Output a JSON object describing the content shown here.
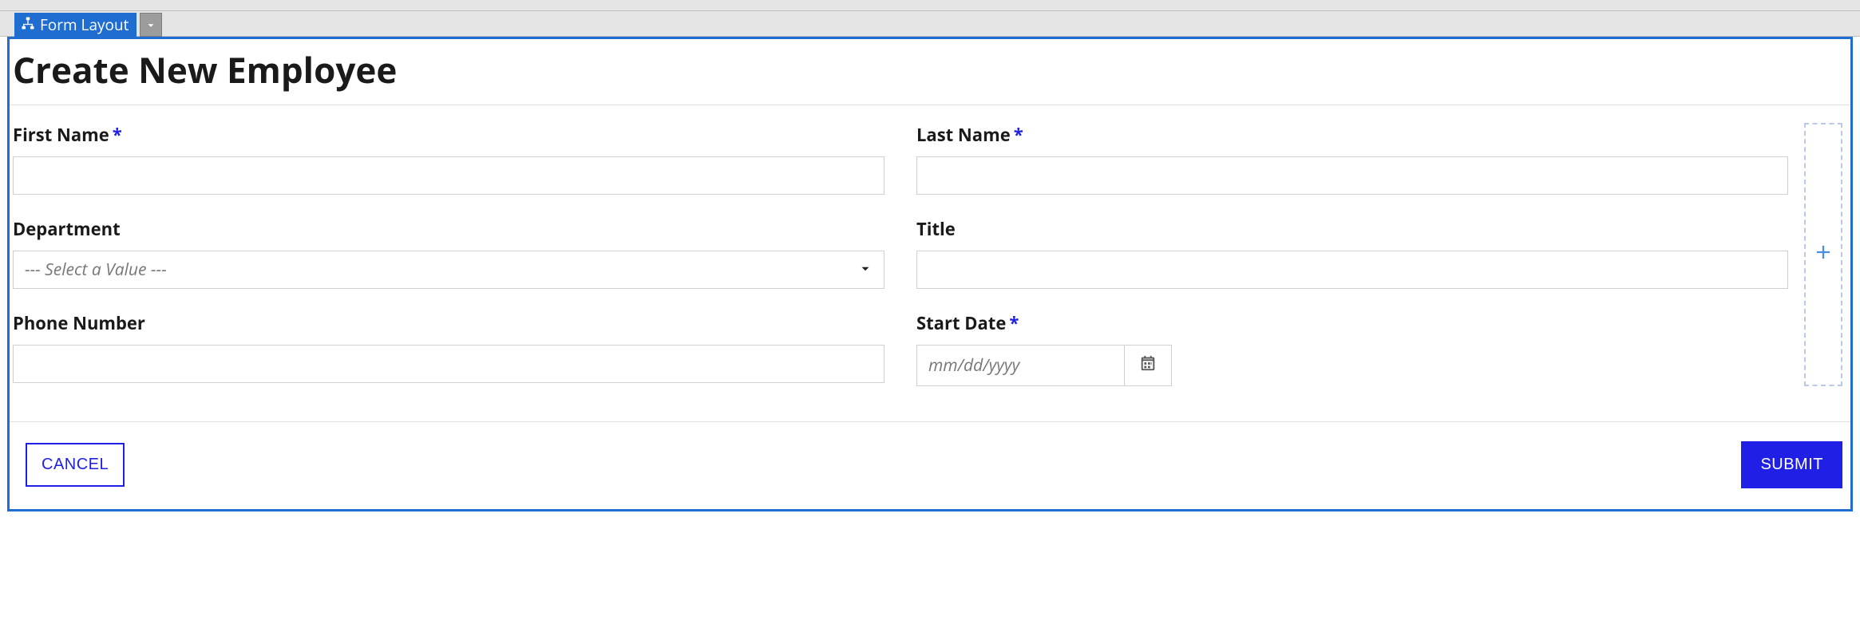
{
  "designer": {
    "component_tag": "Form Layout"
  },
  "form": {
    "title": "Create New Employee",
    "required_marker": "*",
    "fields": {
      "first_name": {
        "label": "First Name",
        "value": "",
        "required": true
      },
      "last_name": {
        "label": "Last Name",
        "value": "",
        "required": true
      },
      "department": {
        "label": "Department",
        "placeholder": "--- Select a Value ---",
        "required": false
      },
      "title": {
        "label": "Title",
        "value": "",
        "required": false
      },
      "phone": {
        "label": "Phone Number",
        "value": "",
        "required": false
      },
      "start_date": {
        "label": "Start Date",
        "placeholder": "mm/dd/yyyy",
        "required": true
      }
    },
    "actions": {
      "cancel": "CANCEL",
      "submit": "SUBMIT"
    }
  }
}
